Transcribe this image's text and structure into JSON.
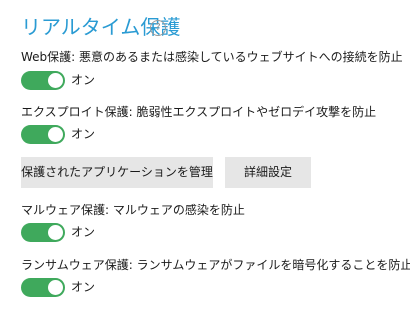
{
  "header": {
    "title": "リアルタイム保護",
    "help_glyph": "?"
  },
  "settings": [
    {
      "label": "Web保護: 悪意のあるまたは感染しているウェブサイトへの接続を防止",
      "state": "オン",
      "on": true
    },
    {
      "label": "エクスプロイト保護: 脆弱性エクスプロイトやゼロデイ攻撃を防止",
      "state": "オン",
      "on": true
    },
    {
      "label": "マルウェア保護: マルウェアの感染を防止",
      "state": "オン",
      "on": true
    },
    {
      "label": "ランサムウェア保護: ランサムウェアがファイルを暗号化することを防止",
      "state": "オン",
      "on": true
    }
  ],
  "buttons": {
    "manage_apps": "保護されたアプリケーションを管理",
    "advanced": "詳細設定"
  },
  "colors": {
    "accent": "#2a9bd3",
    "toggle_on": "#3fa95c",
    "button_bg": "#e6e6e6"
  }
}
